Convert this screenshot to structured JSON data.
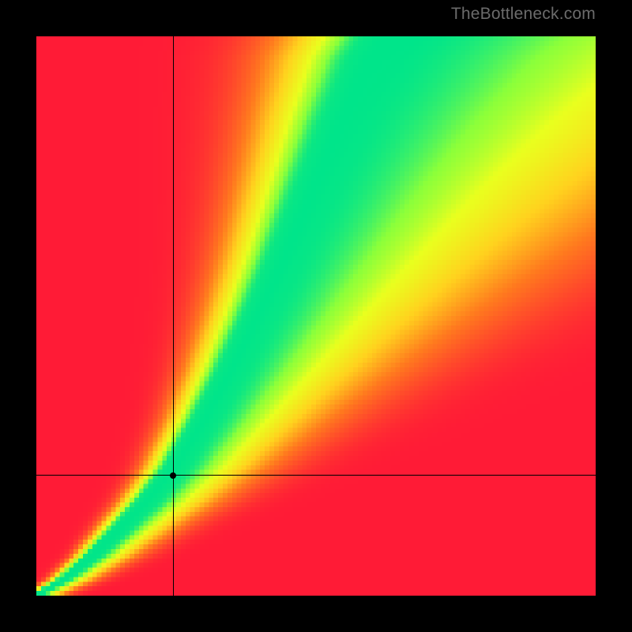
{
  "watermark": "TheBottleneck.com",
  "chart_data": {
    "type": "heatmap",
    "title": "",
    "xlabel": "",
    "ylabel": "",
    "xlim": [
      0,
      1
    ],
    "ylim": [
      0,
      1
    ],
    "grid": false,
    "legend": false,
    "marker": {
      "x": 0.245,
      "y": 0.215
    },
    "crosshair": {
      "x": 0.245,
      "y": 0.215
    },
    "optimal_curve": {
      "description": "green optimal band: y as function of x (normalized)",
      "x": [
        0.0,
        0.05,
        0.1,
        0.15,
        0.2,
        0.25,
        0.3,
        0.35,
        0.4,
        0.45,
        0.5,
        0.55,
        0.6,
        0.63
      ],
      "y": [
        0.0,
        0.03,
        0.07,
        0.12,
        0.17,
        0.23,
        0.31,
        0.4,
        0.5,
        0.61,
        0.73,
        0.85,
        0.96,
        1.0
      ],
      "band_halfwidth_x": [
        0.005,
        0.008,
        0.012,
        0.015,
        0.018,
        0.02,
        0.022,
        0.025,
        0.028,
        0.031,
        0.034,
        0.037,
        0.04,
        0.042
      ]
    },
    "color_stops": {
      "0.00": "#ff1b36",
      "0.35": "#ff7a1e",
      "0.60": "#ffd21e",
      "0.80": "#e9ff1e",
      "0.92": "#8bff3a",
      "1.00": "#00e58a"
    },
    "pixelation_cells": 120
  }
}
